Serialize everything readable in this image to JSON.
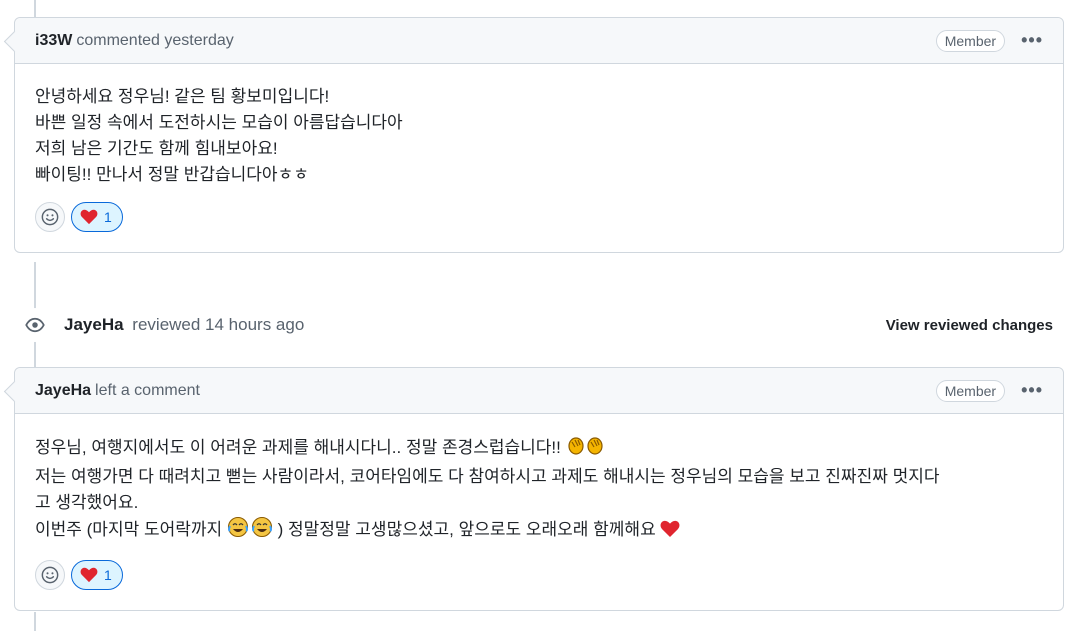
{
  "comment1": {
    "author": "i33W",
    "action": "commented yesterday",
    "badge": "Member",
    "more": "•••",
    "lines": [
      "안녕하세요 정우님! 같은 팀 황보미입니다!",
      "바쁜 일정 속에서 도전하시는 모습이 아름답습니다아",
      "저희 남은 기간도 함께 힘내보아요!",
      "빠이팅!! 만나서 정말 반갑습니다아ㅎㅎ"
    ],
    "heart_count": "1"
  },
  "review": {
    "author": "JayeHa",
    "action": "reviewed 14 hours ago",
    "link": "View reviewed changes"
  },
  "comment2": {
    "author": "JayeHa",
    "action": "left a comment",
    "badge": "Member",
    "more": "•••",
    "line1": "정우님, 여행지에서도 이 어려운 과제를 해내시다니.. 정말 존경스럽습니다!!",
    "line2": "저는 여행가면 다 때려치고 뻗는 사람이라서, 코어타임에도 다 참여하시고 과제도 해내시는 정우님의 모습을 보고 진짜진짜 멋지다",
    "line3": "고 생각했어요.",
    "line4_a": "이번주 (마지막 도어락까지",
    "line4_b": ") 정말정말 고생많으셨고, 앞으로도 오래오래 함께해요",
    "heart_count": "1"
  },
  "colors": {
    "border": "#d0d7de",
    "header_bg": "#f6f8fa",
    "accent": "#0969da",
    "heart": "#cf222e",
    "clap": "#f4b400"
  }
}
